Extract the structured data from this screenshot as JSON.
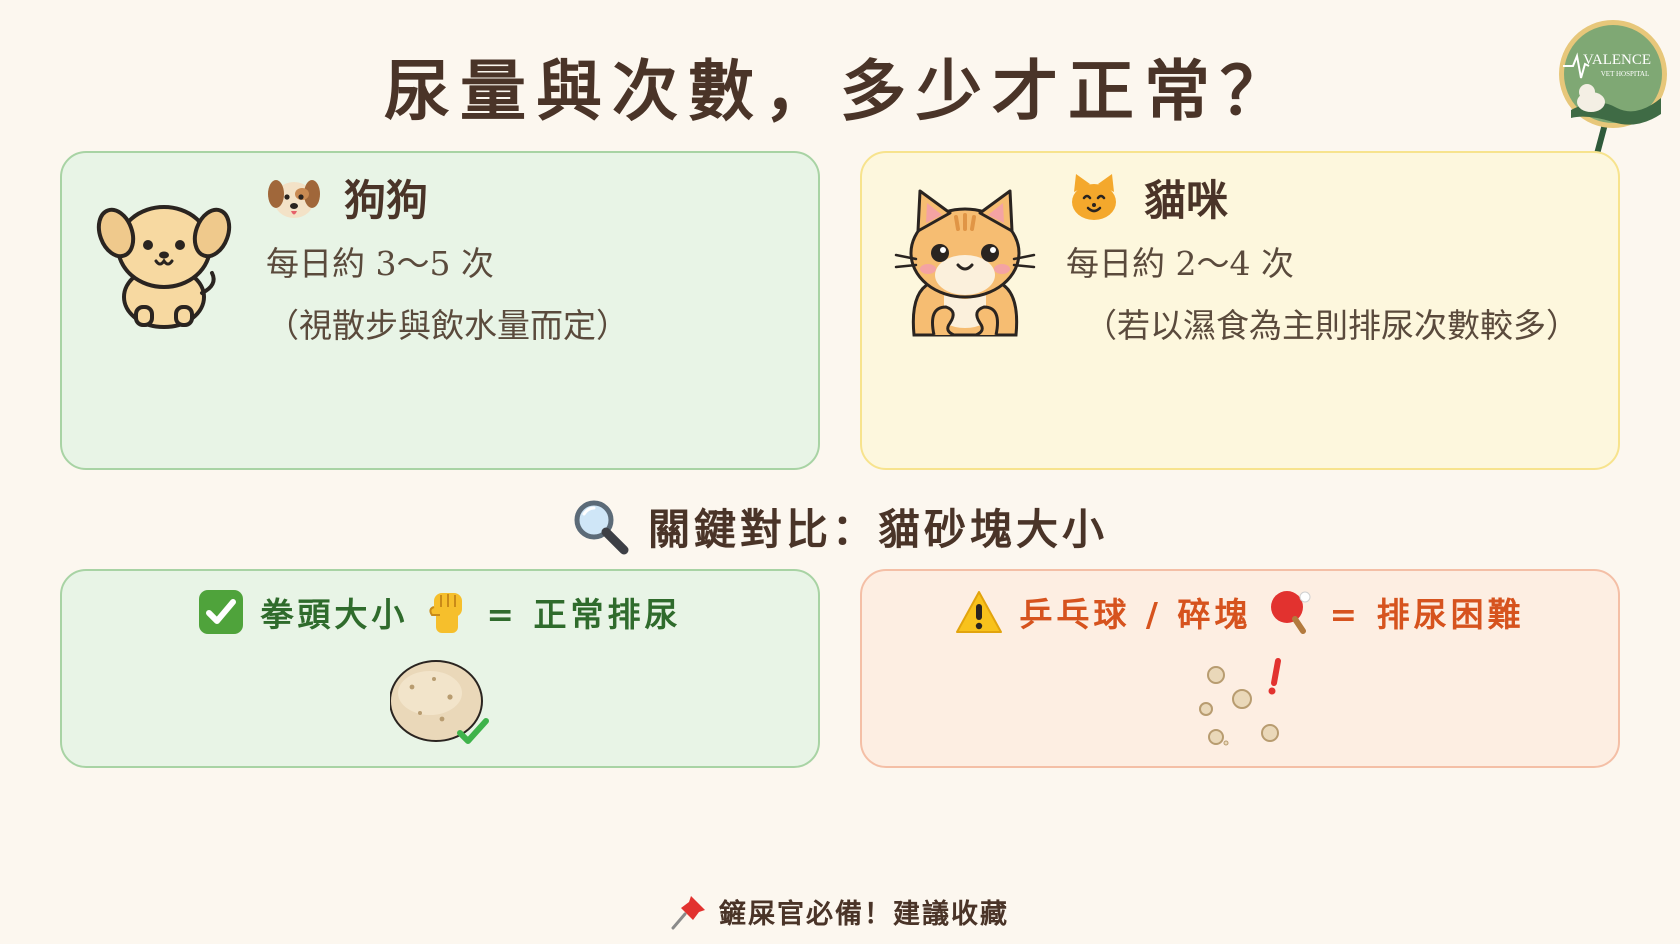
{
  "title": "尿量與次數，多少才正常？",
  "logo": {
    "line1": "VALENCE",
    "line2": "VET HOSPITAL"
  },
  "dog": {
    "icon": "dog-face-icon",
    "name": "狗狗",
    "frequency": "每日約 3〜5 次",
    "note": "（視散步與飲水量而定）"
  },
  "cat": {
    "icon": "cat-face-icon",
    "name": "貓咪",
    "frequency": "每日約 2〜4 次",
    "note": "（若以濕食為主則排尿次數較多）"
  },
  "comparison": {
    "icon": "magnifier-icon",
    "heading": "關鍵對比：貓砂塊大小"
  },
  "good": {
    "icons": [
      "check-box-icon",
      "raised-fist-icon",
      "litter-clump-icon"
    ],
    "size": "拳頭大小",
    "result": "= 正常排尿",
    "color": "#2f6b2c"
  },
  "bad": {
    "icons": [
      "warning-icon",
      "ping-pong-icon",
      "small-clumps-icon"
    ],
    "size": "乒乓球 / 碎塊",
    "result": "= 排尿困難",
    "color": "#d6531e"
  },
  "footer": {
    "icon": "pushpin-icon",
    "text": "鏟屎官必備！建議收藏"
  },
  "colors": {
    "background": "#fcf7ef",
    "green_card": "#e8f4e6",
    "yellow_card": "#fdf7dd",
    "orange_card": "#fdeee2"
  }
}
